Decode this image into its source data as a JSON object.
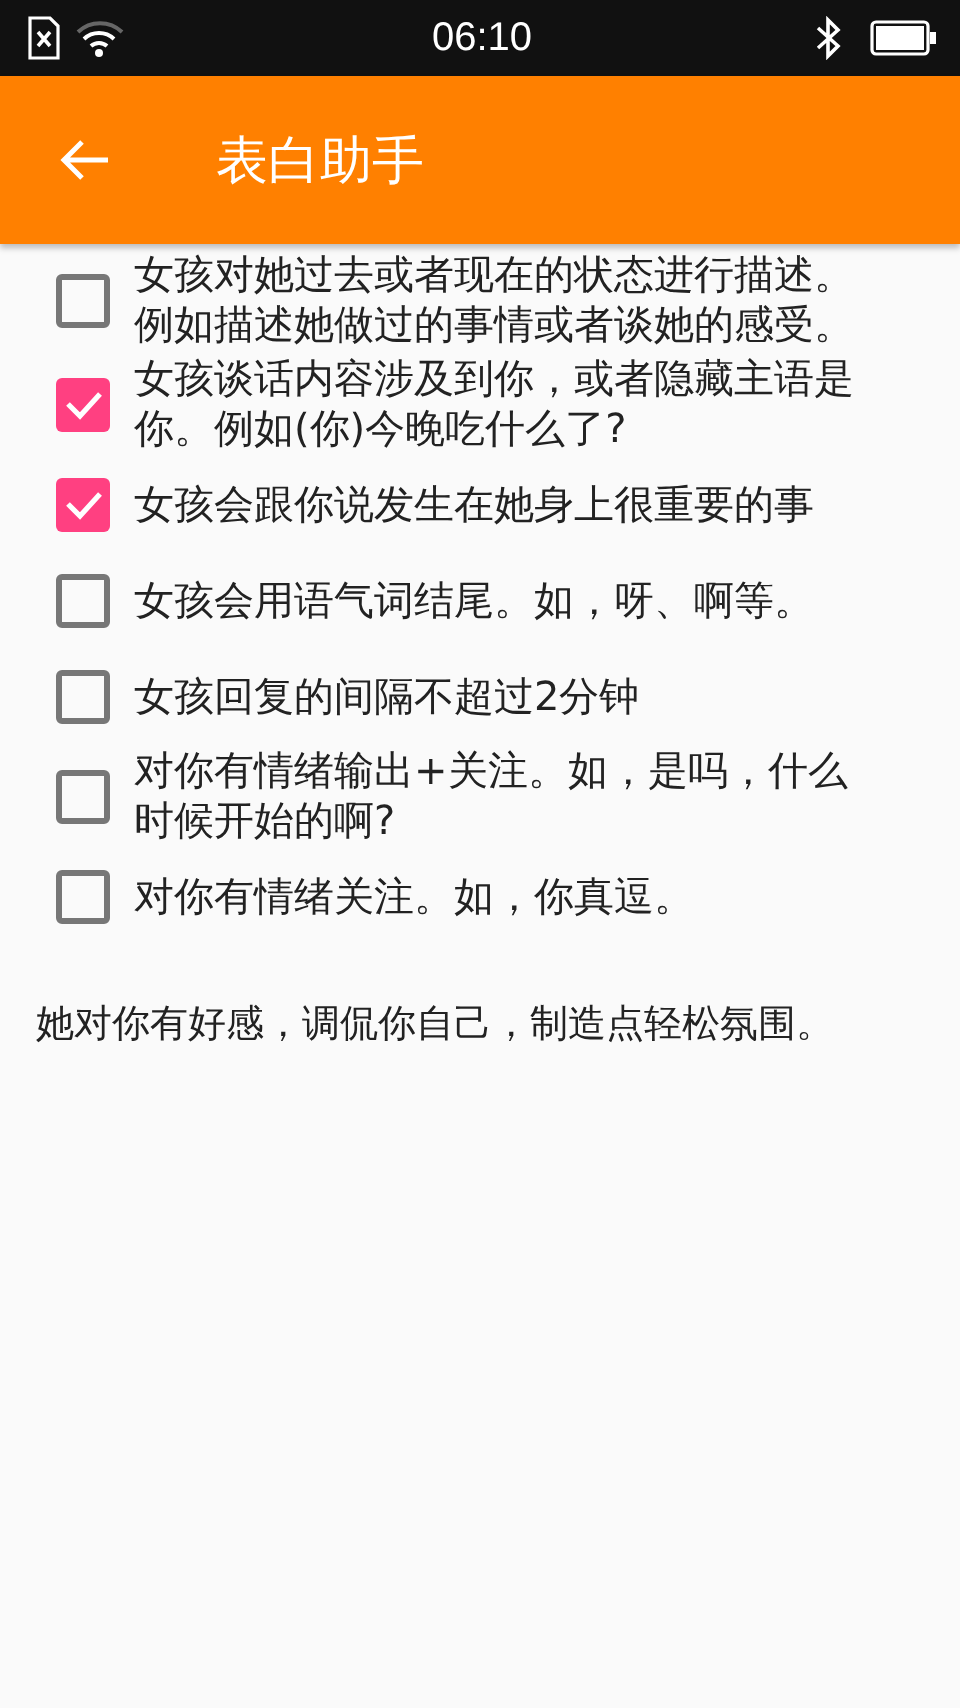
{
  "status_bar": {
    "time": "06:10"
  },
  "app_bar": {
    "title": "表白助手"
  },
  "checklist": [
    {
      "label": "女孩对她过去或者现在的状态进行描述。例如描述她做过的事情或者谈她的感受。",
      "checked": false
    },
    {
      "label": "女孩谈话内容涉及到你，或者隐藏主语是你。例如(你)今晚吃什么了?",
      "checked": true
    },
    {
      "label": "女孩会跟你说发生在她身上很重要的事",
      "checked": true
    },
    {
      "label": "女孩会用语气词结尾。如，呀、啊等。",
      "checked": false
    },
    {
      "label": "女孩回复的间隔不超过2分钟",
      "checked": false
    },
    {
      "label": "对你有情绪输出+关注。如，是吗，什么时候开始的啊?",
      "checked": false
    },
    {
      "label": "对你有情绪关注。如，你真逗。",
      "checked": false
    }
  ],
  "result": "她对你有好感，调侃你自己，制造点轻松氛围。"
}
